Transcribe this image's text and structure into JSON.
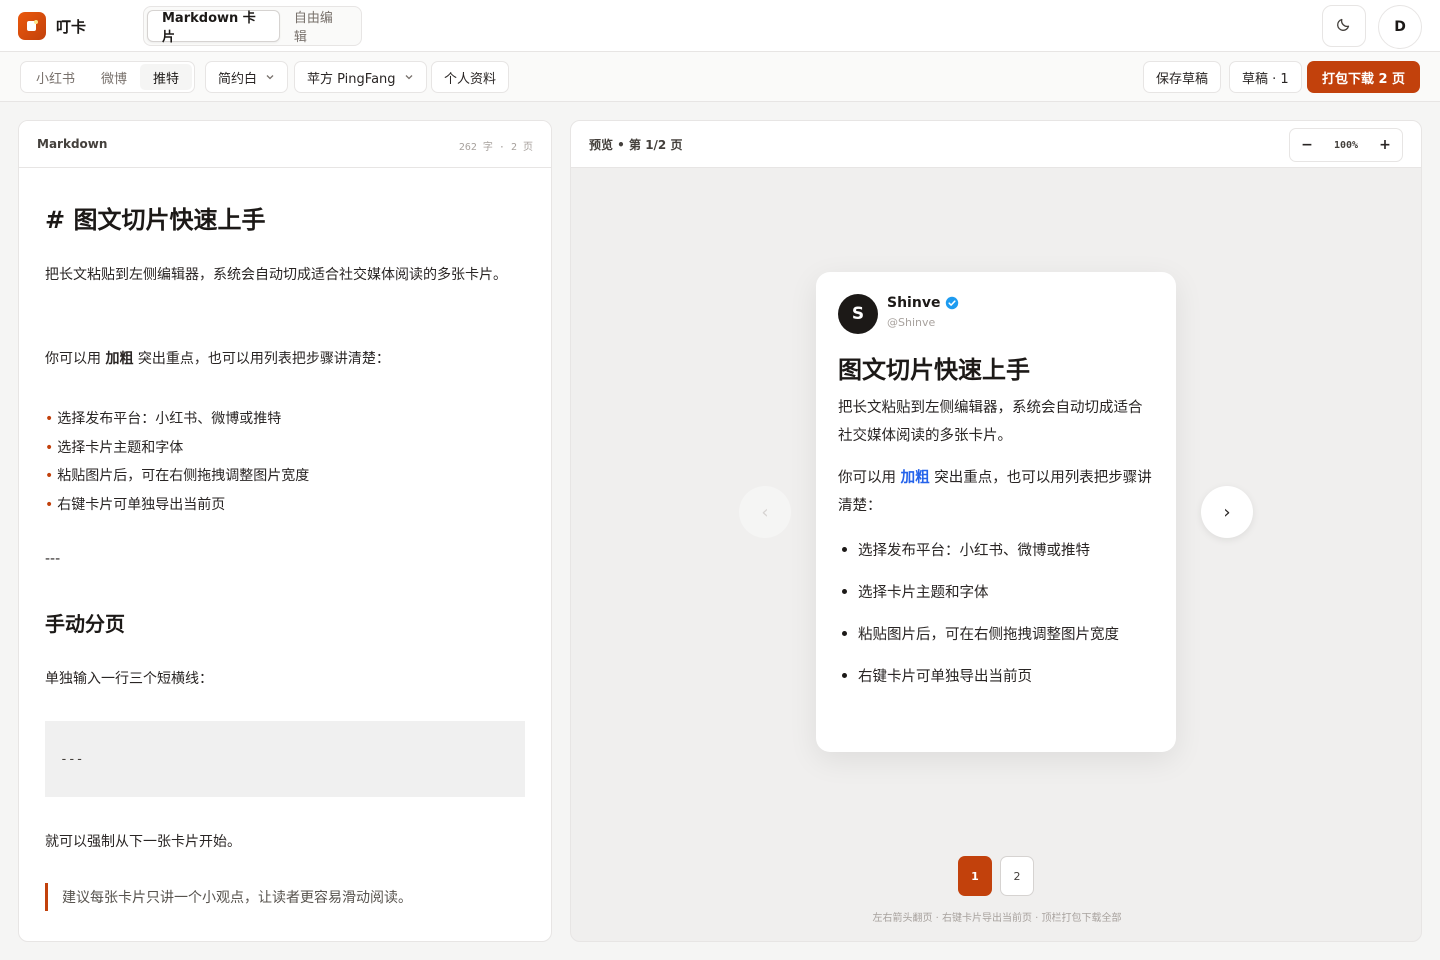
{
  "app": {
    "name": "叮卡"
  },
  "mode_tabs": [
    {
      "label": "Markdown 卡片",
      "active": true
    },
    {
      "label": "自由编辑",
      "active": false
    }
  ],
  "header": {
    "avatar_initial": "D"
  },
  "toolbar": {
    "platforms": [
      {
        "label": "小红书",
        "active": false
      },
      {
        "label": "微博",
        "active": false
      },
      {
        "label": "推特",
        "active": true
      }
    ],
    "theme_select": "简约白",
    "font_select": "苹方 PingFang",
    "profile_label": "个人资料",
    "save_draft": "保存草稿",
    "drafts": "草稿 · 1",
    "download": "打包下载 2 页"
  },
  "editor": {
    "title": "Markdown",
    "meta": "262 字 · 2 页",
    "h1": "# 图文切片快速上手",
    "p1": "把长文粘贴到左侧编辑器，系统会自动切成适合社交媒体阅读的多张卡片。",
    "p2_before": "你可以用 ",
    "p2_bold": "加粗",
    "p2_after": " 突出重点，也可以用列表把步骤讲清楚：",
    "list": [
      "选择发布平台：小红书、微博或推特",
      "选择卡片主题和字体",
      "粘贴图片后，可在右侧拖拽调整图片宽度",
      "右键卡片可单独导出当前页"
    ],
    "hr": "---",
    "h2": "手动分页",
    "p3": "单独输入一行三个短横线：",
    "code": "---",
    "p4": "就可以强制从下一张卡片开始。",
    "quote": "建议每张卡片只讲一个小观点，让读者更容易滑动阅读。"
  },
  "preview": {
    "title": "预览 • 第 1/2 页",
    "zoom": "100%",
    "zoom_minus": "−",
    "zoom_plus": "+",
    "prev_arrow": "‹",
    "next_arrow": "›",
    "card": {
      "avatar": "S",
      "name": "Shinve",
      "handle": "@Shinve",
      "title": "图文切片快速上手",
      "p1": "把长文粘贴到左侧编辑器，系统会自动切成适合社交媒体阅读的多张卡片。",
      "p2_before": "你可以用 ",
      "p2_highlight": "加粗",
      "p2_after": " 突出重点，也可以用列表把步骤讲清楚：",
      "list": [
        "选择发布平台：小红书、微博或推特",
        "选择卡片主题和字体",
        "粘贴图片后，可在右侧拖拽调整图片宽度",
        "右键卡片可单独导出当前页"
      ]
    },
    "pages": [
      {
        "label": "1",
        "active": true
      },
      {
        "label": "2",
        "active": false
      }
    ],
    "hint": "左右箭头翻页 · 右键卡片导出当前页 · 顶栏打包下载全部"
  },
  "colors": {
    "accent": "#c2410c",
    "highlight": "#2563eb",
    "verified": "#1d9bf0"
  },
  "icons": [
    "app-logo-icon",
    "moon-icon",
    "chevron-down-icon",
    "verified-badge-icon"
  ]
}
